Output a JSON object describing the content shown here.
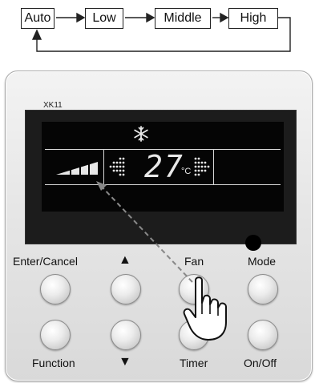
{
  "fan_sequence": {
    "steps": [
      "Auto",
      "Low",
      "Middle",
      "High"
    ]
  },
  "controller": {
    "model": "XK11",
    "display": {
      "temperature": "27",
      "unit": "°C",
      "mode_icon": "snowflake-icon",
      "fan_speed_icon": "fan-speed-bar-icon"
    },
    "buttons": {
      "enter_cancel": "Enter/Cancel",
      "up": "▲",
      "fan": "Fan",
      "mode": "Mode",
      "function": "Function",
      "down": "▼",
      "timer": "Timer",
      "on_off": "On/Off"
    }
  },
  "colors": {
    "lcd_background": "#050505",
    "lcd_segment": "#e8e8e8",
    "panel": "#e6e6e6",
    "pointer_arrow": "#888888"
  }
}
